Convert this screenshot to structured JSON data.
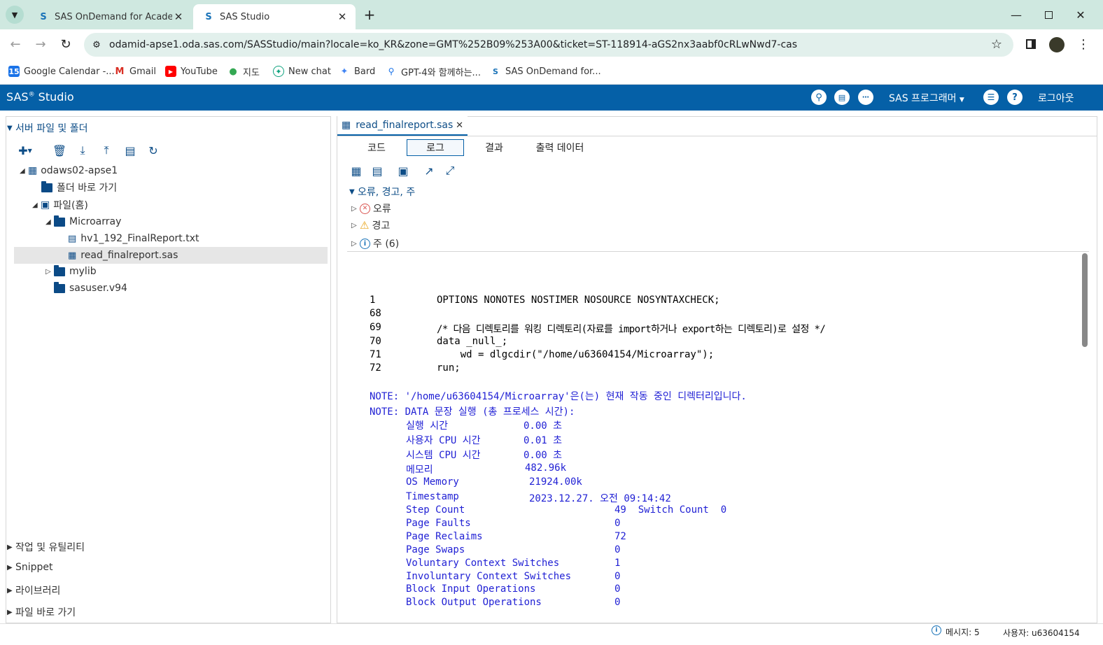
{
  "browser": {
    "tabs": [
      {
        "title": "SAS OnDemand for Academics",
        "active": false
      },
      {
        "title": "SAS Studio",
        "active": true
      }
    ],
    "url": "odamid-apse1.oda.sas.com/SASStudio/main?locale=ko_KR&zone=GMT%252B09%253A00&ticket=ST-118914-aGS2nx3aabf0cRLwNwd7-cas",
    "bookmarks": [
      "Google Calendar -...",
      "Gmail",
      "YouTube",
      "지도",
      "New chat",
      "Bard",
      "GPT-4와 함께하는...",
      "SAS OnDemand for..."
    ]
  },
  "app": {
    "title": "SAS",
    "title_sup": "®",
    "title_rest": "Studio",
    "role_menu": "SAS 프로그래머",
    "logout": "로그아웃"
  },
  "left": {
    "server_section": "서버 파일 및 폴더",
    "tree": {
      "server": "odaws02-apse1",
      "shortcuts": "폴더 바로 가기",
      "home": "파일(홈)",
      "microarray": "Microarray",
      "file_txt": "hv1_192_FinalReport.txt",
      "file_sas": "read_finalreport.sas",
      "mylib": "mylib",
      "sasuser": "sasuser.v94"
    },
    "sections": [
      "작업 및 유틸리티",
      "Snippet",
      "라이브러리",
      "파일 바로 가기"
    ]
  },
  "editor": {
    "file_tab": "read_finalreport.sas",
    "subtabs": [
      "코드",
      "로그",
      "결과",
      "출력 데이터"
    ],
    "active_subtab": "로그",
    "summary_header": "오류, 경고, 주",
    "errors": "오류",
    "warnings": "경고",
    "notes": "주 (6)"
  },
  "log": {
    "code_lines": [
      {
        "num": "1",
        "text": "OPTIONS NONOTES NOSTIMER NOSOURCE NOSYNTAXCHECK;"
      },
      {
        "num": "68",
        "text": ""
      },
      {
        "num": "69",
        "text": "/* 다음 디렉토리를 워킹 디렉토리(자료를 import하거나 export하는 디렉토리)로 설정 */"
      },
      {
        "num": "70",
        "text": "data _null_;"
      },
      {
        "num": "71",
        "text": "    wd = dlgcdir(\"/home/u63604154/Microarray\");"
      },
      {
        "num": "72",
        "text": "run;"
      }
    ],
    "note1": "NOTE: '/home/u63604154/Microarray'은(는) 현재 작동 중인 디렉터리입니다.",
    "note2": "NOTE: DATA 문장 실행 (총 프로세스 시간):",
    "stats": [
      {
        "label": "실행 시간",
        "value": "0.00 초"
      },
      {
        "label": "사용자 CPU 시간",
        "value": "0.01 초"
      },
      {
        "label": "시스템 CPU 시간",
        "value": "0.00 초"
      },
      {
        "label": "메모리",
        "value": "482.96k"
      },
      {
        "label": "OS Memory",
        "value": "21924.00k"
      },
      {
        "label": "Timestamp",
        "value": "2023.12.27. 오전 09:14:42"
      },
      {
        "label": "Step Count",
        "value": "49  Switch Count  0"
      },
      {
        "label": "Page Faults",
        "value": "0"
      },
      {
        "label": "Page Reclaims",
        "value": "72"
      },
      {
        "label": "Page Swaps",
        "value": "0"
      },
      {
        "label": "Voluntary Context Switches",
        "value": "1"
      },
      {
        "label": "Involuntary Context Switches",
        "value": "0"
      },
      {
        "label": "Block Input Operations",
        "value": "0"
      },
      {
        "label": "Block Output Operations",
        "value": "0"
      }
    ]
  },
  "status": {
    "messages": "메시지: 5",
    "user": "사용자: u63604154"
  }
}
